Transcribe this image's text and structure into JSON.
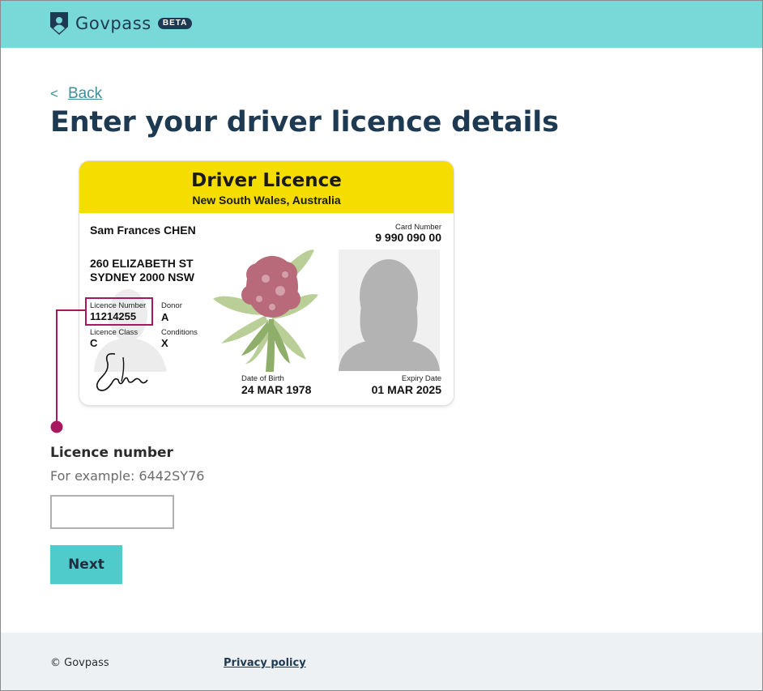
{
  "header": {
    "brand_name": "Govpass",
    "beta_badge": "BETA",
    "brand_icon": "shield-user-icon",
    "background_color": "#79d8d8",
    "brand_color": "#1e3a52"
  },
  "nav": {
    "back_chevron": "<",
    "back_label": "Back"
  },
  "page": {
    "title": "Enter your driver licence details"
  },
  "licence_card": {
    "title": "Driver Licence",
    "subtitle": "New South Wales, Australia",
    "name": "Sam Frances CHEN",
    "address_line1": "260 ELIZABETH ST",
    "address_line2": "SYDNEY 2000 NSW",
    "licence_number_label": "Licence Number",
    "licence_number": "11214255",
    "donor_label": "Donor",
    "donor": "A",
    "licence_class_label": "Licence Class",
    "licence_class": "C",
    "conditions_label": "Conditions",
    "conditions": "X",
    "card_number_label": "Card Number",
    "card_number": "9 990 090 00",
    "dob_label": "Date of Birth",
    "dob": "24 MAR 1978",
    "expiry_label": "Expiry Date",
    "expiry": "01 MAR 2025",
    "header_color": "#f5dd00",
    "highlight_color": "#a8185f"
  },
  "form": {
    "label": "Licence number",
    "hint": "For example: 6442SY76",
    "value": "",
    "next_label": "Next",
    "button_color": "#4fcbcb"
  },
  "footer": {
    "copyright": "© Govpass",
    "privacy_label": "Privacy policy"
  }
}
